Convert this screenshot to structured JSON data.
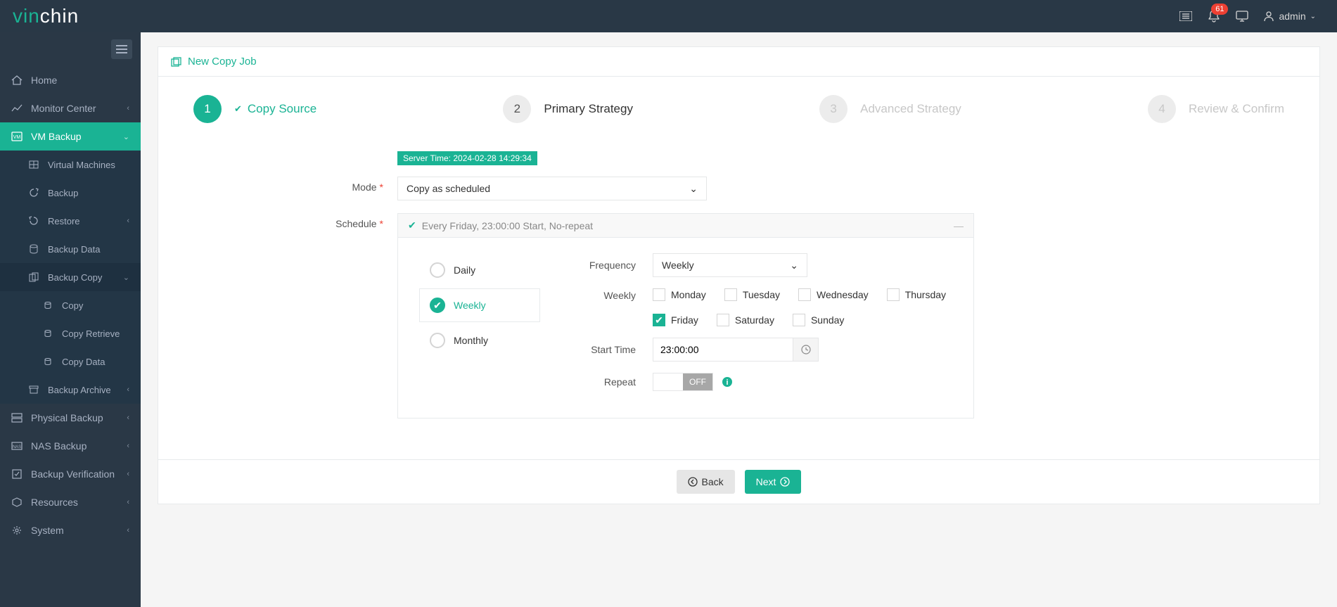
{
  "brand": {
    "part1": "vin",
    "part2": "chin"
  },
  "header": {
    "notif_count": "61",
    "user_label": "admin"
  },
  "sidebar": {
    "home": "Home",
    "monitor": "Monitor Center",
    "vm_backup": "VM Backup",
    "vm_children": {
      "virtual_machines": "Virtual Machines",
      "backup": "Backup",
      "restore": "Restore",
      "backup_data": "Backup Data",
      "backup_copy": "Backup Copy",
      "copy": "Copy",
      "copy_retrieve": "Copy Retrieve",
      "copy_data": "Copy Data",
      "backup_archive": "Backup Archive"
    },
    "physical_backup": "Physical Backup",
    "nas_backup": "NAS Backup",
    "backup_verification": "Backup Verification",
    "resources": "Resources",
    "system": "System"
  },
  "page": {
    "title": "New Copy Job",
    "server_time": "Server Time: 2024-02-28 14:29:34",
    "steps": {
      "s1": {
        "num": "1",
        "label": "Copy Source"
      },
      "s2": {
        "num": "2",
        "label": "Primary Strategy"
      },
      "s3": {
        "num": "3",
        "label": "Advanced Strategy"
      },
      "s4": {
        "num": "4",
        "label": "Review & Confirm"
      }
    },
    "form": {
      "mode_label": "Mode",
      "mode_value": "Copy as scheduled",
      "schedule_label": "Schedule",
      "schedule_summary": "Every Friday, 23:00:00 Start, No-repeat",
      "interval": {
        "daily": "Daily",
        "weekly": "Weekly",
        "monthly": "Monthly"
      },
      "fields": {
        "frequency_label": "Frequency",
        "frequency_value": "Weekly",
        "weekly_label": "Weekly",
        "days": {
          "mon": "Monday",
          "tue": "Tuesday",
          "wed": "Wednesday",
          "thu": "Thursday",
          "fri": "Friday",
          "sat": "Saturday",
          "sun": "Sunday"
        },
        "start_time_label": "Start Time",
        "start_time_value": "23:00:00",
        "repeat_label": "Repeat",
        "repeat_off": "OFF"
      }
    },
    "actions": {
      "back": "Back",
      "next": "Next"
    }
  }
}
